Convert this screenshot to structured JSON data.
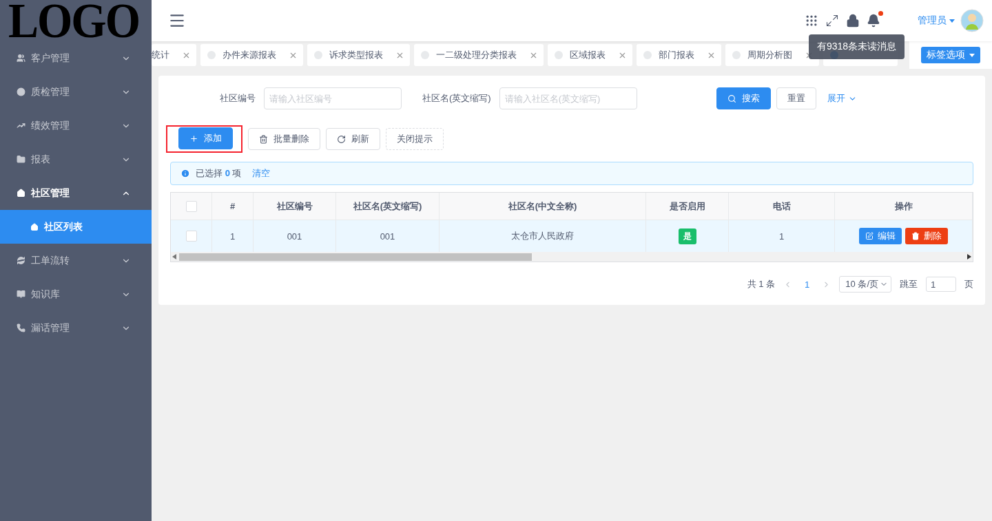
{
  "logo": "LOGO",
  "sidebar": {
    "items": [
      {
        "label": "客户管理",
        "expanded": false
      },
      {
        "label": "质检管理",
        "expanded": false
      },
      {
        "label": "绩效管理",
        "expanded": false
      },
      {
        "label": "报表",
        "expanded": false
      },
      {
        "label": "社区管理",
        "expanded": true,
        "children": [
          {
            "label": "社区列表",
            "selected": true
          }
        ]
      },
      {
        "label": "工单流转",
        "expanded": false
      },
      {
        "label": "知识库",
        "expanded": false
      },
      {
        "label": "漏话管理",
        "expanded": false
      }
    ]
  },
  "header": {
    "has_unread": true,
    "tooltip": "有9318条未读消息",
    "user": "管理员"
  },
  "tabs": [
    {
      "label": "统计",
      "selected": false
    },
    {
      "label": "办件来源报表",
      "selected": false
    },
    {
      "label": "诉求类型报表",
      "selected": false
    },
    {
      "label": "一二级处理分类报表",
      "selected": false
    },
    {
      "label": "区域报表",
      "selected": false
    },
    {
      "label": "部门报表",
      "selected": false
    },
    {
      "label": "周期分析图",
      "selected": false
    },
    {
      "selected": true
    }
  ],
  "tab_options": "标签选项",
  "filters": [
    {
      "label": "社区编号",
      "placeholder": "请输入社区编号"
    },
    {
      "label": "社区名(英文缩写)",
      "placeholder": "请输入社区名(英文缩写)"
    }
  ],
  "search_button": "搜索",
  "reset_button": "重置",
  "expand_link": "展开",
  "toolbar": [
    {
      "kind": "add",
      "label": "添加",
      "highlighted": true
    },
    {
      "kind": "delete",
      "label": "批量删除",
      "highlighted": false
    },
    {
      "kind": "refresh",
      "label": "刷新",
      "highlighted": false
    },
    {
      "kind": "dashed",
      "label": "关闭提示",
      "highlighted": false
    }
  ],
  "selection": {
    "prefix": "已选择",
    "count": "0",
    "suffix": "项",
    "clear": "清空"
  },
  "table": {
    "all_checked": false,
    "columns": [
      "#",
      "社区编号",
      "社区名(英文缩写)",
      "社区名(中文全称)",
      "是否启用",
      "电话",
      "操作"
    ],
    "rows": [
      {
        "checked": false,
        "index": "1",
        "code": "001",
        "name_en": "001",
        "name_cn": "太仓市人民政府",
        "enabled": "是",
        "phone": "1",
        "actions": [
          "编辑",
          "删除"
        ]
      }
    ]
  },
  "pagination": {
    "total": "共 1 条",
    "pages": [
      {
        "label": "1",
        "selected": true
      }
    ],
    "page_size": "10 条/页",
    "jump_label": "跳至",
    "jump_value": "1",
    "page_suffix": "页"
  }
}
